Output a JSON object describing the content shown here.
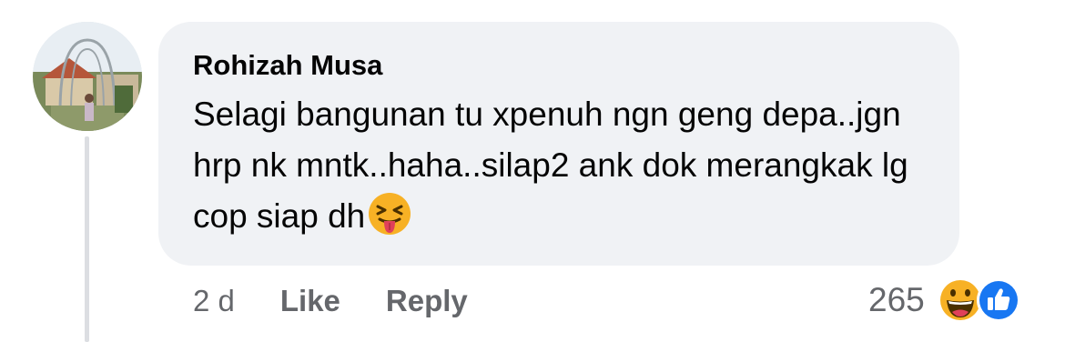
{
  "comment": {
    "author": "Rohizah Musa",
    "text": "Selagi bangunan tu xpenuh ngn geng depa..jgn hrp nk mntk..haha..silap2 ank dok merangkak lg cop siap dh",
    "inline_emoji": "squinting-tongue-emoji"
  },
  "actions": {
    "time": "2 d",
    "like_label": "Like",
    "reply_label": "Reply"
  },
  "reactions": {
    "count": "265",
    "icons": [
      "haha-reaction-icon",
      "like-reaction-icon"
    ]
  },
  "colors": {
    "bubble": "#f0f2f5",
    "meta_text": "#65676b",
    "like_blue": "#1877f2",
    "haha_yellow": "#f7b125"
  }
}
